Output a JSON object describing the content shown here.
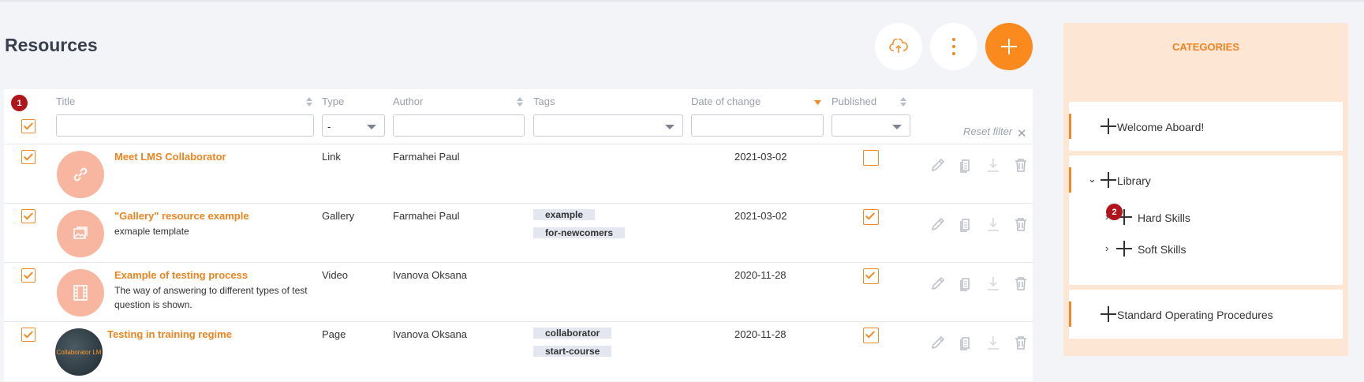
{
  "page": {
    "title": "Resources"
  },
  "toolbar": {
    "upload_icon": "cloud-upload-icon",
    "more_icon": "more-vertical-icon",
    "add_icon": "plus-icon",
    "accent": "#fb8a1e"
  },
  "table": {
    "columns": {
      "title": "Title",
      "type": "Type",
      "author": "Author",
      "tags": "Tags",
      "date": "Date of change",
      "published": "Published"
    },
    "filters": {
      "title": "",
      "type": "-",
      "author": "",
      "tags": "",
      "date": "",
      "published": ""
    },
    "reset_filter": "Reset filter",
    "header_badge": "1",
    "rows": [
      {
        "title": "Meet LMS Collaborator",
        "description": "",
        "type": "Link",
        "author": "Farmahei Paul",
        "tags": [],
        "date": "2021-03-02",
        "published": false,
        "selected": true,
        "icon": "link-icon"
      },
      {
        "title": "\"Gallery\" resource example",
        "description": "exmaple template",
        "type": "Gallery",
        "author": "Farmahei Paul",
        "tags": [
          "example",
          "for-newcomers"
        ],
        "date": "2021-03-02",
        "published": true,
        "selected": true,
        "icon": "gallery-icon"
      },
      {
        "title": "Example of testing process",
        "description": "The way of answering to different types of test question is shown.",
        "type": "Video",
        "author": "Ivanova Oksana",
        "tags": [],
        "date": "2020-11-28",
        "published": true,
        "selected": true,
        "icon": "film-icon"
      },
      {
        "title": "Testing in training regime",
        "description": "",
        "type": "Page",
        "author": "Ivanova Oksana",
        "tags": [
          "collaborator",
          "start-course"
        ],
        "date": "2020-11-28",
        "published": true,
        "selected": true,
        "icon": "photo-thumbnail",
        "thumb_text": "Collaborator LM"
      }
    ],
    "row_actions": [
      "pencil-icon",
      "copy-icon",
      "download-icon",
      "trash-icon"
    ]
  },
  "sidebar": {
    "title": "CATEGORIES",
    "categories": [
      {
        "label": "Welcome Aboard!"
      },
      {
        "label": "Library",
        "children": [
          {
            "label": "Hard Skills",
            "badge": "2"
          },
          {
            "label": "Soft Skills"
          }
        ]
      },
      {
        "label": "Standard Operating Procedures"
      }
    ]
  }
}
